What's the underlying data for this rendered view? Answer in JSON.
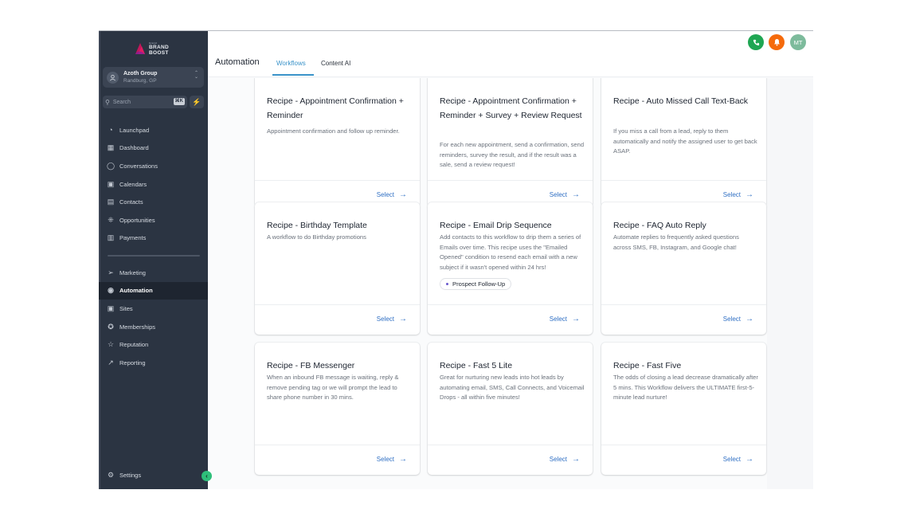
{
  "sidebar": {
    "logo": {
      "line1": "BRAND",
      "line2": "BOOST",
      "small": "brand"
    },
    "account": {
      "name": "Azoth Group",
      "location": "Randburg, GP"
    },
    "search": {
      "placeholder": "Search",
      "shortcut": "⌘K"
    },
    "nav_top": [
      {
        "label": "Launchpad",
        "icon": "rocket-icon",
        "glyph": "◔"
      },
      {
        "label": "Dashboard",
        "icon": "grid-icon",
        "glyph": "▦"
      },
      {
        "label": "Conversations",
        "icon": "chat-bubble-icon",
        "glyph": "◯"
      },
      {
        "label": "Calendars",
        "icon": "calendar-icon",
        "glyph": "▣"
      },
      {
        "label": "Contacts",
        "icon": "contact-book-icon",
        "glyph": "▤"
      },
      {
        "label": "Opportunities",
        "icon": "funnel-people-icon",
        "glyph": "⁜"
      },
      {
        "label": "Payments",
        "icon": "receipt-icon",
        "glyph": "▥"
      }
    ],
    "nav_bottom": [
      {
        "label": "Marketing",
        "icon": "send-icon",
        "glyph": "➢"
      },
      {
        "label": "Automation",
        "icon": "automation-icon",
        "glyph": "◉"
      },
      {
        "label": "Sites",
        "icon": "globe-window-icon",
        "glyph": "▣"
      },
      {
        "label": "Memberships",
        "icon": "award-icon",
        "glyph": "✪"
      },
      {
        "label": "Reputation",
        "icon": "star-icon",
        "glyph": "☆"
      },
      {
        "label": "Reporting",
        "icon": "trend-up-icon",
        "glyph": "↗"
      }
    ],
    "active_item": "Automation",
    "settings_label": "Settings"
  },
  "header": {
    "title": "Automation",
    "tabs": [
      {
        "label": "Workflows",
        "active": true
      },
      {
        "label": "Content AI",
        "active": false
      }
    ],
    "actions": {
      "phone_color": "#1fa653",
      "bell_color": "#f56a0b",
      "avatar_initials": "MT",
      "avatar_color": "#7dbb9c"
    }
  },
  "cards": [
    {
      "title": "Recipe - Appointment Confirmation + Reminder",
      "description": "Appointment confirmation and follow up reminder.",
      "select_label": "Select"
    },
    {
      "title": "Recipe - Appointment Confirmation + Reminder + Survey + Review Request",
      "description": "For each new appointment, send a confirmation, send reminders, survey the result, and if the result was a sale, send a review request!",
      "select_label": "Select"
    },
    {
      "title": "Recipe - Auto Missed Call Text-Back",
      "description": "If you miss a call from a lead, reply to them automatically and notify the assigned user to get back ASAP.",
      "select_label": "Select"
    },
    {
      "title": "Recipe - Birthday Template",
      "description": "A workflow to do Birthday promotions",
      "select_label": "Select"
    },
    {
      "title": "Recipe - Email Drip Sequence",
      "description": "Add contacts to this workflow to drip them a series of Emails over time. This recipe uses the \"Emailed Opened\" condition to resend each email with a new subject if it wasn't opened within 24 hrs!",
      "tag": "Prospect Follow-Up",
      "select_label": "Select"
    },
    {
      "title": "Recipe - FAQ Auto Reply",
      "description": "Automate replies to frequently asked questions across SMS, FB, Instagram, and Google chat!",
      "select_label": "Select"
    },
    {
      "title": "Recipe - FB Messenger",
      "description": "When an inbound FB message is waiting, reply & remove pending tag or we will prompt the lead to share phone number in 30 mins.",
      "select_label": "Select"
    },
    {
      "title": "Recipe - Fast 5 Lite",
      "description": "Great for nurturing new leads into hot leads by automating email, SMS, Call Connects, and Voicemail Drops - all within five minutes!",
      "select_label": "Select"
    },
    {
      "title": "Recipe - Fast Five",
      "description": "The odds of closing a lead decrease dramatically after 5 mins. This Workflow delivers the ULTIMATE first-5-minute lead nurture!",
      "select_label": "Select"
    }
  ]
}
